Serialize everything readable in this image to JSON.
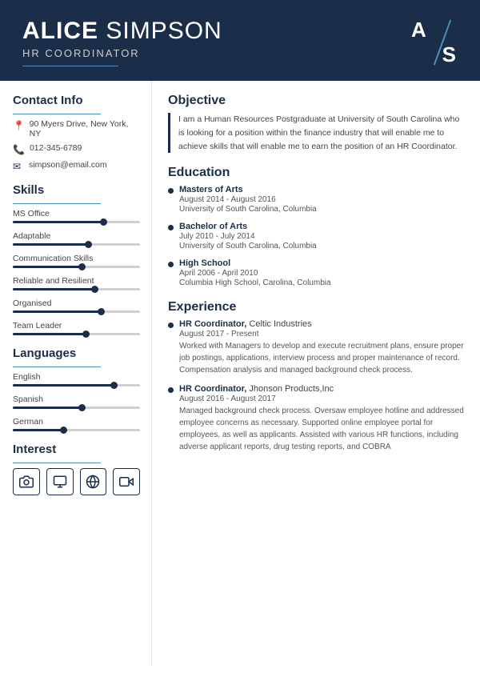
{
  "header": {
    "first_name": "ALICE",
    "last_name": "SIMPSON",
    "title": "HR COORDINATOR",
    "monogram_top": "A",
    "monogram_bottom": "S"
  },
  "contact": {
    "section_title": "Contact Info",
    "address": "90 Myers Drive, New York, NY",
    "phone": "012-345-6789",
    "email": "simpson@email.com"
  },
  "skills": {
    "section_title": "Skills",
    "items": [
      {
        "label": "MS Office",
        "pct": 72
      },
      {
        "label": "Adaptable",
        "pct": 60
      },
      {
        "label": "Communication Skills",
        "pct": 55
      },
      {
        "label": "Reliable and Resilient",
        "pct": 65
      },
      {
        "label": "Organised",
        "pct": 70
      },
      {
        "label": "Team Leader",
        "pct": 58
      }
    ]
  },
  "languages": {
    "section_title": "Languages",
    "items": [
      {
        "label": "English",
        "pct": 80
      },
      {
        "label": "Spanish",
        "pct": 55
      },
      {
        "label": "German",
        "pct": 40
      }
    ]
  },
  "interest": {
    "section_title": "Interest",
    "icons": [
      "camera",
      "person",
      "globe",
      "video"
    ]
  },
  "objective": {
    "section_title": "Objective",
    "text": "I am a Human Resources Postgraduate at University of South Carolina who is looking for a position within the finance industry that will enable me to achieve skills that will enable me to earn the position of an HR Coordinator."
  },
  "education": {
    "section_title": "Education",
    "items": [
      {
        "degree": "Masters of Arts",
        "date": "August 2014 - August 2016",
        "school": "University of South Carolina, Columbia"
      },
      {
        "degree": "Bachelor of Arts",
        "date": "July 2010 - July 2014",
        "school": "University of South Carolina, Columbia"
      },
      {
        "degree": "High School",
        "date": "April 2006 - April 2010",
        "school": "Columbia High School, Carolina, Columbia"
      }
    ]
  },
  "experience": {
    "section_title": "Experience",
    "items": [
      {
        "role": "HR Coordinator",
        "company": "Celtic Industries",
        "date": "August 2017 - Present",
        "desc": "Worked with Managers to develop and execute recruitment plans, ensure proper job postings, applications, interview process and proper maintenance of record. Compensation analysis and managed background check process."
      },
      {
        "role": "HR Coordinator",
        "company": "Jhonson Products,Inc",
        "date": "August 2016 - August 2017",
        "desc": "Managed background check process. Oversaw employee hotline and addressed employee concerns as necessary. Supported online employee portal for employees, as well as applicants. Assisted with various HR functions, including adverse applicant reports, drug testing reports, and COBRA"
      }
    ]
  }
}
